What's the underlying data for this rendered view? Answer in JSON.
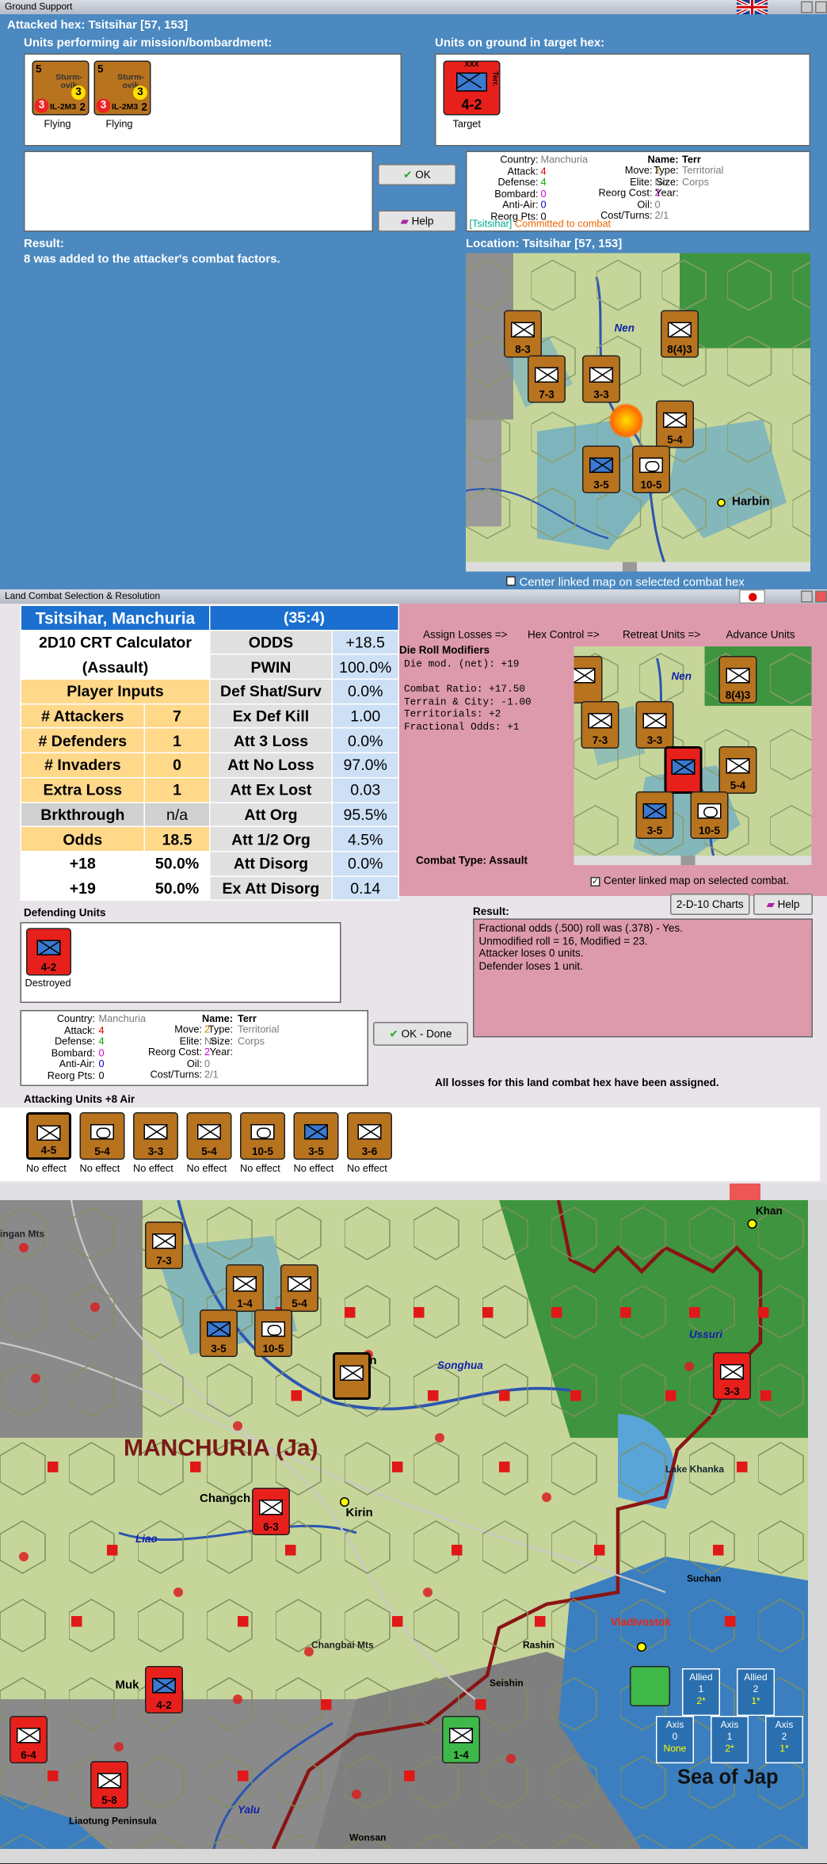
{
  "ground_support": {
    "title": "Ground Support",
    "attacked_hex": "Attacked hex: Tsitsihar  [57, 153]",
    "air_label": "Units performing air mission/bombardment:",
    "ground_label": "Units on ground in target hex:",
    "air_units": [
      {
        "top": "5",
        "name": "Sturm-ovik",
        "att": "3",
        "bottom_left": "3",
        "model": "IL-2M3",
        "bottom_right": "2",
        "status": "Flying"
      },
      {
        "top": "5",
        "name": "Sturm-ovik",
        "att": "3",
        "bottom_left": "3",
        "model": "IL-2M3",
        "bottom_right": "2",
        "status": "Flying"
      }
    ],
    "target_unit": {
      "size": "XXX",
      "side": "Terr.",
      "strength": "4-2",
      "caption": "Target"
    },
    "ok_label": "OK",
    "help_label": "Help",
    "info": {
      "country_label": "Country:",
      "country": "Manchuria",
      "attack_label": "Attack:",
      "attack": "4",
      "defense_label": "Defense:",
      "defense": "4",
      "bombard_label": "Bombard:",
      "bombard": "0",
      "antiair_label": "Anti-Air:",
      "antiair": "0",
      "reorg_label": "Reorg Pts:",
      "reorg": "0",
      "move_label": "Move:",
      "move": "2",
      "elite_label": "Elite:",
      "elite": "No",
      "reorgcost_label": "Reorg Cost:",
      "reorgcost": "2",
      "oil_label": "Oil:",
      "oil": "0",
      "cost_label": "Cost/Turns:",
      "cost": "2/1",
      "name_label": "Name:",
      "name": "Terr",
      "type_label": "Type:",
      "type": "Territorial",
      "size_label": "Size:",
      "size": "Corps",
      "year_label": "Year:",
      "year": "",
      "tag": "[Tsitsihar]",
      "committed": "Committed to combat"
    },
    "result_label": "Result:",
    "result_text": "8 was added to the attacker's combat factors.",
    "location": "Location:  Tsitsihar  [57, 153]",
    "map_labels": {
      "nen": "Nen",
      "harbin": "Harbin"
    },
    "map_counters": [
      "8-3",
      "8(4)3",
      "7-3",
      "3-3",
      "5-4",
      "3-5",
      "10-5"
    ],
    "center_label": "Center linked map on selected combat hex"
  },
  "land_combat": {
    "title": "Land Combat Selection & Resolution",
    "crt": {
      "location": "Tsitsihar, Manchuria",
      "ratio": "(35:4)",
      "calc_title_1": "2D10 CRT Calculator",
      "calc_title_2": "(Assault)",
      "player_inputs": "Player Inputs",
      "rows_left": [
        {
          "label": "# Attackers",
          "value": "7"
        },
        {
          "label": "# Defenders",
          "value": "1"
        },
        {
          "label": "# Invaders",
          "value": "0"
        },
        {
          "label": "Extra Loss",
          "value": "1"
        },
        {
          "label": "Brkthrough",
          "value": "n/a"
        },
        {
          "label": "Odds",
          "value": "18.5"
        },
        {
          "label": "+18",
          "value": "50.0%"
        },
        {
          "label": "+19",
          "value": "50.0%"
        }
      ],
      "rows_right": [
        {
          "label": "ODDS",
          "value": "+18.5"
        },
        {
          "label": "PWIN",
          "value": "100.0%"
        },
        {
          "label": "Def Shat/Surv",
          "value": "0.0%"
        },
        {
          "label": "Ex Def Kill",
          "value": "1.00"
        },
        {
          "label": "Att 3 Loss",
          "value": "0.0%"
        },
        {
          "label": "Att No Loss",
          "value": "97.0%"
        },
        {
          "label": "Att Ex Lost",
          "value": "0.03"
        },
        {
          "label": "Att Org",
          "value": "95.5%"
        },
        {
          "label": "Att 1/2 Org",
          "value": "4.5%"
        },
        {
          "label": "Att Disorg",
          "value": "0.0%"
        },
        {
          "label": "Ex Att Disorg",
          "value": "0.14"
        }
      ]
    },
    "tabs": [
      "Assign Losses =>",
      "Hex Control =>",
      "Retreat Units =>",
      "Advance Units"
    ],
    "die_mod_title": "Die Roll Modifiers",
    "die_mod_lines": [
      "Die mod. (net): +19",
      "",
      "Combat Ratio: +17.50",
      "Terrain & City: -1.00",
      "Territorials: +2",
      "Fractional Odds: +1"
    ],
    "combat_type": "Combat Type:  Assault",
    "center_label": "Center linked map on selected combat.",
    "charts_label": "2-D-10 Charts",
    "help_label": "Help",
    "defending_label": "Defending Units",
    "defender": {
      "strength": "4-2",
      "status": "Destroyed"
    },
    "result_label": "Result:",
    "result_lines": [
      "Fractional odds (.500) roll was (.378)  - Yes.",
      "Unmodified roll = 16, Modified = 23.",
      "Attacker loses 0 units.",
      "Defender loses 1 unit."
    ],
    "ok_done": "OK - Done",
    "all_losses": "All losses for this land combat hex have been assigned.",
    "attacking_label": "Attacking Units +8 Air",
    "attackers": [
      {
        "strength": "4-5",
        "status": "No effect",
        "color": "#b8731f"
      },
      {
        "strength": "5-4",
        "status": "No effect",
        "color": "#b8731f"
      },
      {
        "strength": "3-3",
        "status": "No effect",
        "color": "#b8731f"
      },
      {
        "strength": "5-4",
        "status": "No effect",
        "color": "#b8731f"
      },
      {
        "strength": "10-5",
        "status": "No effect",
        "color": "#b8731f"
      },
      {
        "strength": "3-5",
        "status": "No effect",
        "color": "#b8731f"
      },
      {
        "strength": "3-6",
        "status": "No effect",
        "color": "#b8731f"
      }
    ],
    "info": {
      "country": "Manchuria",
      "attack": "4",
      "defense": "4",
      "bombard": "0",
      "antiair": "0",
      "reorg": "0",
      "move": "2",
      "elite": "No",
      "reorgcost": "2",
      "oil": "0",
      "cost": "2/1",
      "name": "Terr",
      "type": "Territorial",
      "size": "Corps",
      "year": ""
    }
  },
  "main_map": {
    "region_label": "MANCHURIA (Ja)",
    "places": [
      "Changch",
      "Kirin",
      "Liao",
      "Songhua",
      "Ussuri",
      "Lake Khanka",
      "Suchan",
      "Vladivostok",
      "Rashin",
      "Seishin",
      "Changbai Mts",
      "Muk",
      "Wonsan",
      "Liaotung Peninsula",
      "Yalu",
      "Sea of Jap",
      "bin",
      "ingan Mts",
      "Khan"
    ],
    "counters": [
      "7-3",
      "1-4",
      "5-4",
      "3-5",
      "10-5",
      "6-3",
      "3-3",
      "4-2",
      "6-4",
      "5-8",
      "1-4"
    ],
    "status_boxes": {
      "allied_label": "Allied",
      "axis_label": "Axis",
      "allied": [
        {
          "v": "1",
          "s": "2*"
        },
        {
          "v": "2",
          "s": "1*"
        }
      ],
      "axis": [
        {
          "v": "0",
          "s": "None"
        },
        {
          "v": "1",
          "s": "2*"
        },
        {
          "v": "2",
          "s": "1*"
        }
      ]
    }
  }
}
